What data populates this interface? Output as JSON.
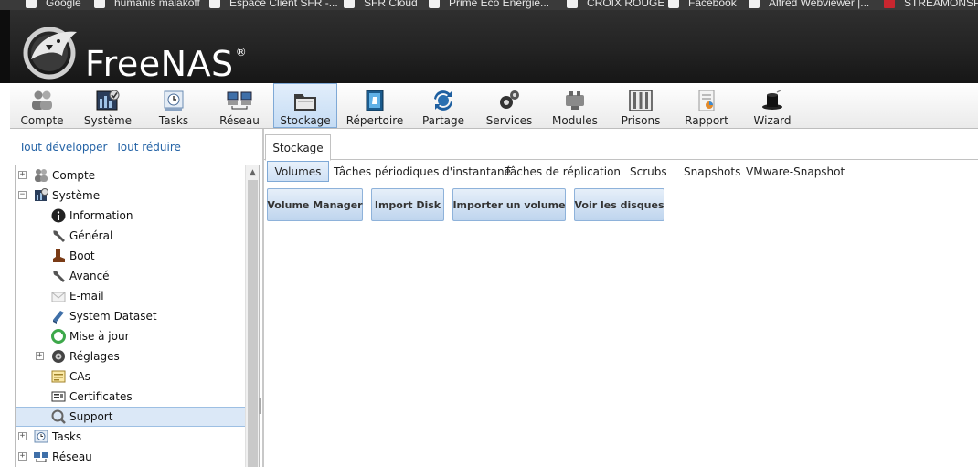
{
  "bookmarks": [
    {
      "label": "Google"
    },
    {
      "label": "humanis malakoff"
    },
    {
      "label": "Espace Client SFR -..."
    },
    {
      "label": "SFR Cloud"
    },
    {
      "label": "Prime Eco Energie..."
    },
    {
      "label": "CROIX ROUGE"
    },
    {
      "label": "Facebook"
    },
    {
      "label": "Alfred Webviewer |..."
    },
    {
      "label": "STREAMONSPO"
    }
  ],
  "header": {
    "brand": "FreeNAS",
    "trademark": "®"
  },
  "toolbar": [
    {
      "label": "Compte",
      "icon": "users-icon"
    },
    {
      "label": "Système",
      "icon": "system-monitor-icon"
    },
    {
      "label": "Tasks",
      "icon": "clock-icon"
    },
    {
      "label": "Réseau",
      "icon": "network-icon"
    },
    {
      "label": "Stockage",
      "icon": "folder-icon"
    },
    {
      "label": "Répertoire",
      "icon": "directory-book-icon"
    },
    {
      "label": "Partage",
      "icon": "sharing-arrows-icon"
    },
    {
      "label": "Services",
      "icon": "gears-icon"
    },
    {
      "label": "Modules",
      "icon": "plugin-icon"
    },
    {
      "label": "Prisons",
      "icon": "jail-bars-icon"
    },
    {
      "label": "Rapport",
      "icon": "report-icon"
    },
    {
      "label": "Wizard",
      "icon": "wizard-hat-icon"
    }
  ],
  "toolbar_active": "Stockage",
  "left_panel": {
    "expand_all": "Tout développer",
    "collapse_all": "Tout réduire",
    "tree": [
      {
        "label": "Compte",
        "icon": "users-icon",
        "expander": "+"
      },
      {
        "label": "Système",
        "icon": "system-monitor-icon",
        "expander": "−"
      },
      {
        "label": "Information",
        "icon": "info-icon"
      },
      {
        "label": "Général",
        "icon": "wrench-icon"
      },
      {
        "label": "Boot",
        "icon": "boot-icon"
      },
      {
        "label": "Avancé",
        "icon": "wrench-icon"
      },
      {
        "label": "E-mail",
        "icon": "email-icon"
      },
      {
        "label": "System Dataset",
        "icon": "dataset-icon"
      },
      {
        "label": "Mise à jour",
        "icon": "update-icon"
      },
      {
        "label": "Réglages",
        "icon": "tunables-icon",
        "expander": "+"
      },
      {
        "label": "CAs",
        "icon": "certificate-authority-icon"
      },
      {
        "label": "Certificates",
        "icon": "certificate-icon"
      },
      {
        "label": "Support",
        "icon": "support-icon",
        "selected": true
      },
      {
        "label": "Tasks",
        "icon": "clock-icon",
        "expander": "+"
      },
      {
        "label": "Réseau",
        "icon": "network-icon",
        "expander": "+"
      }
    ]
  },
  "content": {
    "tab": "Stockage",
    "subtabs": [
      "Volumes",
      "Tâches périodiques d'instantané",
      "Tâches de réplication",
      "Scrubs",
      "Snapshots",
      "VMware-Snapshot"
    ],
    "active_subtab": "Volumes",
    "buttons": [
      "Volume Manager",
      "Import Disk",
      "Importer un volume",
      "Voir les disques"
    ]
  },
  "colors": {
    "accent": "#2463a6",
    "selection": "#dbe8f7",
    "header_bg": "#1c1c1c"
  }
}
